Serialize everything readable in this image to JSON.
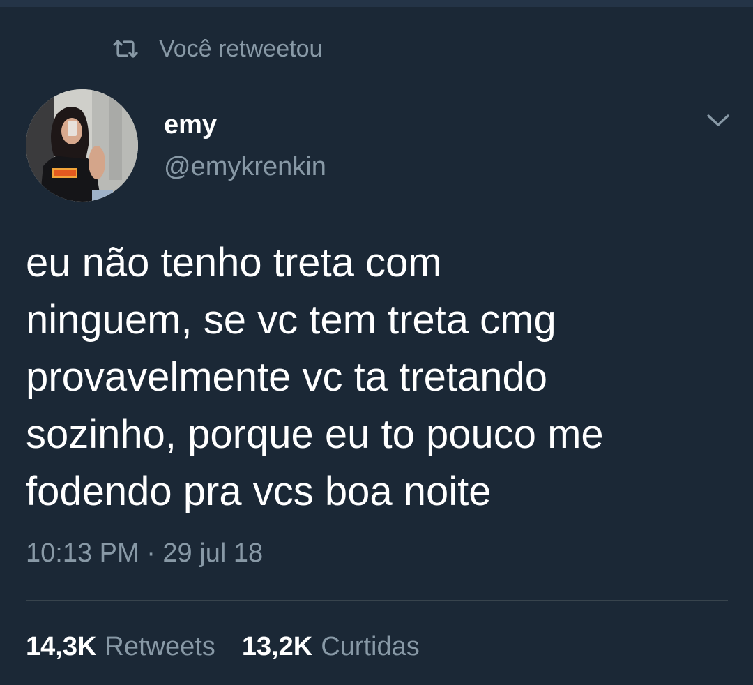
{
  "colors": {
    "background": "#1b2836",
    "primary_text": "#ffffff",
    "secondary_text": "#8899a6",
    "divider": "#38444d"
  },
  "retweet_context": {
    "icon": "retweet-icon",
    "text": "Você retweetou"
  },
  "author": {
    "avatar_icon": "avatar-photo",
    "display_name": "emy",
    "handle": "@emykrenkin"
  },
  "menu": {
    "icon": "chevron-down-icon"
  },
  "tweet": {
    "text": "eu não tenho treta com\nninguem, se vc tem treta cmg\nprovavelmente vc ta tretando\nsozinho, porque eu to pouco me\nfodendo pra vcs boa noite",
    "timestamp": "10:13 PM · 29 jul 18"
  },
  "stats": {
    "retweets_count": "14,3K",
    "retweets_label": "Retweets",
    "likes_count": "13,2K",
    "likes_label": "Curtidas"
  }
}
